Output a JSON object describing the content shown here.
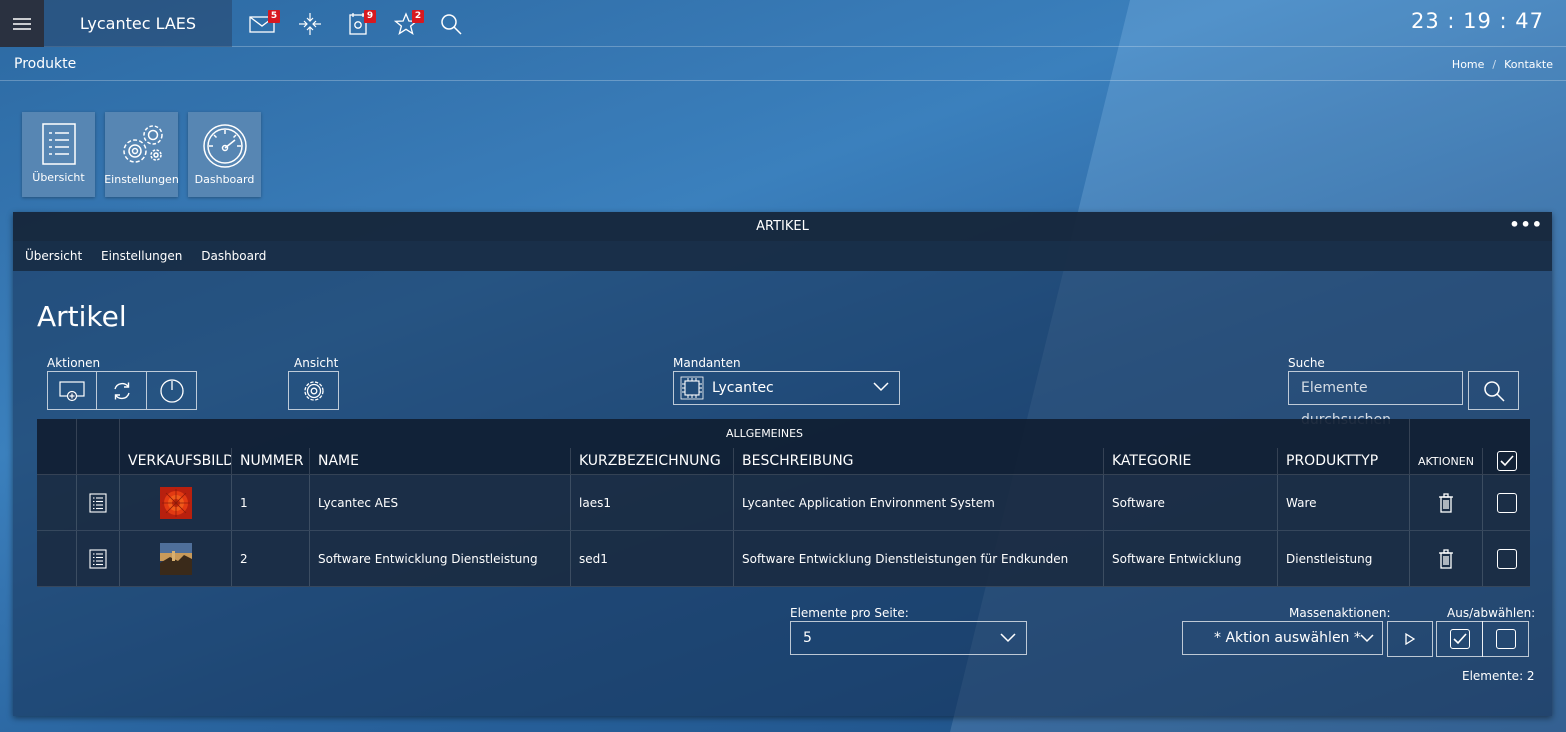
{
  "topbar": {
    "brand": "Lycantec LAES",
    "badges": {
      "mail": "5",
      "tasks": "9",
      "favorites": "2"
    },
    "clock": "23 : 19 : 47"
  },
  "breadcrumb": {
    "title": "Produkte",
    "items": [
      "Home",
      "Kontakte"
    ],
    "separator": "/"
  },
  "tiles": [
    {
      "label": "Übersicht",
      "icon": "list-icon"
    },
    {
      "label": "Einstellungen",
      "icon": "gears-icon"
    },
    {
      "label": "Dashboard",
      "icon": "gauge-icon"
    }
  ],
  "panel": {
    "header": "ARTIKEL",
    "nav": [
      "Übersicht",
      "Einstellungen",
      "Dashboard"
    ],
    "title": "Artikel",
    "labels": {
      "aktionen": "Aktionen",
      "ansicht": "Ansicht",
      "mandanten": "Mandanten",
      "suche": "Suche"
    },
    "mandant_value": "Lycantec",
    "search_placeholder": "Elemente durchsuchen"
  },
  "table": {
    "group_header": "ALLGEMEINES",
    "columns": [
      "VERKAUFSBILD",
      "NUMMER",
      "NAME",
      "KURZBEZEICHNUNG",
      "BESCHREIBUNG",
      "KATEGORIE",
      "PRODUKTTYP",
      "AKTIONEN"
    ],
    "rows": [
      {
        "nummer": "1",
        "name": "Lycantec AES",
        "kurz": "laes1",
        "beschreibung": "Lycantec Application Environment System",
        "kategorie": "Software",
        "typ": "Ware"
      },
      {
        "nummer": "2",
        "name": "Software Entwicklung Dienstleistung",
        "kurz": "sed1",
        "beschreibung": "Software Entwicklung Dienstleistungen für Endkunden",
        "kategorie": "Software Entwicklung",
        "typ": "Dienstleistung"
      }
    ]
  },
  "footer": {
    "per_page_label": "Elemente pro Seite:",
    "per_page_value": "5",
    "mass_label": "Massenaktionen:",
    "mass_value": "* Aktion auswählen *",
    "select_label": "Aus/abwählen:",
    "count": "Elemente: 2"
  },
  "colors": {
    "accent_badge": "#d71920",
    "menu_bg": "#2a3140"
  }
}
